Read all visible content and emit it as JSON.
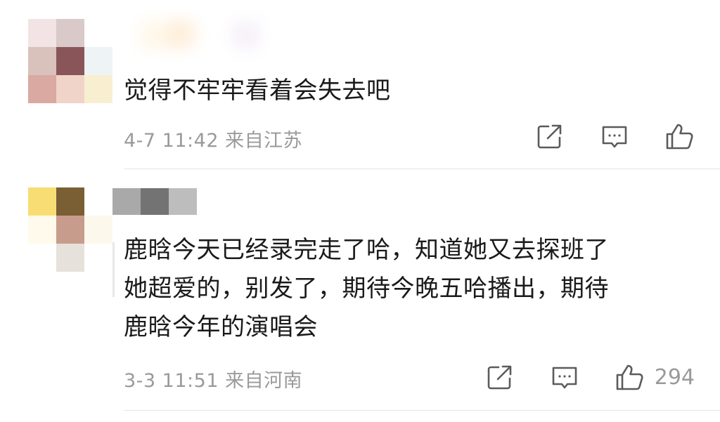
{
  "comments": [
    {
      "text_lines": [
        "觉得不牢牢看着会失去吧"
      ],
      "date": "4-7 11:42",
      "location": "来自江苏",
      "like_count": "",
      "avatar_colors": [
        "#f2e4e4",
        "#d9c9c9",
        "#ffffff",
        "#d8c2bb",
        "#8a5559",
        "#eef3f5",
        "#d9a9a2",
        "#f0d4c9",
        "#f8efd0"
      ],
      "name_colors": []
    },
    {
      "text_lines": [
        "鹿晗今天已经录完走了哈，知道她又去探班了",
        "她超爱的，别发了，期待今晚五哈播出，期待",
        "鹿晗今年的演唱会"
      ],
      "date": "3-3 11:51",
      "location": "来自河南",
      "like_count": "294",
      "avatar_colors": [
        "#f8dd74",
        "#7a5e34",
        "#ffffff",
        "#fffaeb",
        "#c89c8c",
        "#fdf8ec",
        "#ffffff",
        "#e6e1da",
        "#ffffff"
      ],
      "name_colors": [
        "#a9a9a9",
        "#737373",
        "#bdbdbd"
      ]
    }
  ],
  "icons": {
    "share": "share-icon",
    "reply": "comment-icon",
    "like": "thumbs-up-icon"
  },
  "colors": {
    "text": "#1a1a1a",
    "meta": "#9a9a9a",
    "icon": "#5b5b5b",
    "divider": "#e6e6e6"
  }
}
